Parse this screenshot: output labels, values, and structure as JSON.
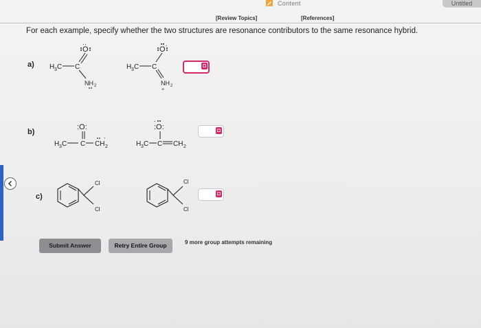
{
  "topbar": {
    "content_tab": "Content",
    "untitled_tab": "Untitled"
  },
  "links": {
    "review_topics": "[Review Topics]",
    "references": "[References]"
  },
  "question": "For each example, specify whether the two structures are resonance contributors to the same resonance hybrid.",
  "items": [
    {
      "label": "a)"
    },
    {
      "label": "b)"
    },
    {
      "label": "c)"
    }
  ],
  "buttons": {
    "submit": "Submit Answer",
    "retry": "Retry Entire Group"
  },
  "attempts": "9 more group attempts remaining",
  "colors": {
    "accent": "#d4286a",
    "sidebar": "#2a62c9"
  }
}
